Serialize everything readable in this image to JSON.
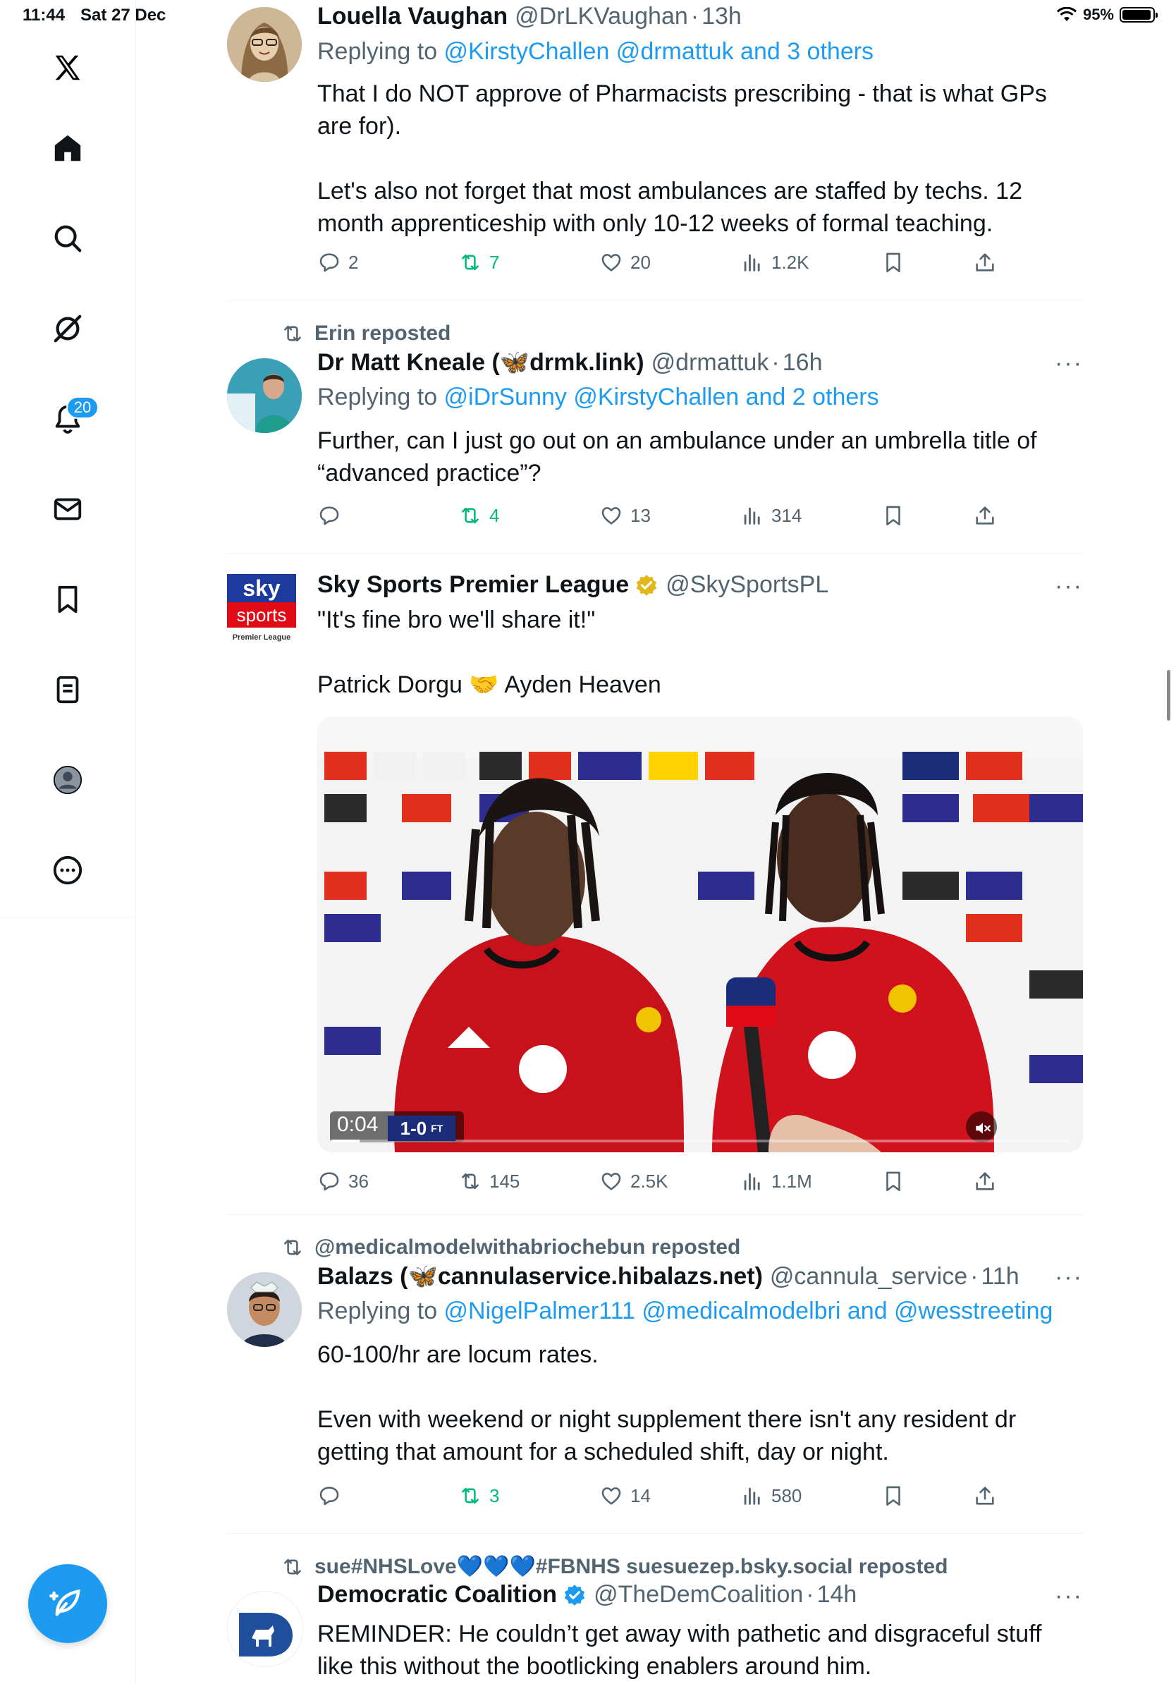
{
  "status_bar": {
    "time": "11:44",
    "date": "Sat 27 Dec",
    "battery": "95%"
  },
  "sidebar": {
    "notifications_badge": "20",
    "items": [
      "x-logo-icon",
      "home-icon",
      "search-icon",
      "grok-icon",
      "notifications-icon",
      "messages-icon",
      "bookmarks-icon",
      "lists-icon",
      "profile-icon",
      "more-icon"
    ]
  },
  "tweets": [
    {
      "name": "Louella Vaughan",
      "handle": "@DrLKVaughan",
      "time": "13h",
      "reply_prefix": "Replying to ",
      "reply_links": "@KirstyChallen @drmattuk and 3 others",
      "text": "That I do NOT approve of Pharmacists prescribing - that is what GPs are for).\n\nLet's also not forget that most ambulances are staffed by techs. 12 month apprenticeship with only 10-12 weeks of formal teaching.",
      "replies": "2",
      "reposts": "7",
      "likes": "20",
      "views": "1.2K"
    },
    {
      "repost_by": "Erin reposted",
      "name": "Dr Matt Kneale (🦋drmk.link)",
      "handle": "@drmattuk",
      "time": "16h",
      "reply_prefix": "Replying to ",
      "reply_links": "@iDrSunny @KirstyChallen and 2 others",
      "text": "Further, can I just go out on an ambulance under an umbrella title of “advanced practice”?",
      "replies": "",
      "reposts": "4",
      "likes": "13",
      "views": "314",
      "more": "···"
    },
    {
      "name": "Sky Sports Premier League",
      "handle": "@SkySportsPL",
      "text": "\"It's fine bro we'll share it!\"\n\nPatrick Dorgu 🤝 Ayden Heaven",
      "video_time": "0:04",
      "score": "1-0",
      "score_ft": "FT",
      "replies": "36",
      "reposts": "145",
      "likes": "2.5K",
      "views": "1.1M",
      "more": "···",
      "avatar_text_1": "sky",
      "avatar_text_2": "sports",
      "avatar_text_3": "Premier League"
    },
    {
      "repost_by": "@medicalmodelwithabriochebun reposted",
      "name": "Balazs (🦋cannulaservice.hibalazs.net)",
      "handle": "@cannula_service",
      "time": "11h",
      "reply_prefix": "Replying to ",
      "reply_links": "@NigelPalmer111 @medicalmodelbri and @wesstreeting",
      "text": "60-100/hr are locum rates.\n\nEven with weekend or night supplement there isn't any resident dr getting that amount for a scheduled shift, day or night.",
      "replies": "",
      "reposts": "3",
      "likes": "14",
      "views": "580",
      "more": "···"
    },
    {
      "repost_by": "sue#NHSLove💙💙💙#FBNHS suesuezep.bsky.social reposted",
      "name": "Democratic Coalition",
      "handle": "@TheDemCoalition",
      "time": "14h",
      "text": "REMINDER: He couldn’t get away with pathetic and disgraceful stuff like this without the bootlicking enablers around him.",
      "more": "···"
    }
  ],
  "colors": {
    "accent": "#1d9bf0",
    "muted": "#536471",
    "repost_green": "#00ba7c",
    "separator": "#eff3f4"
  }
}
